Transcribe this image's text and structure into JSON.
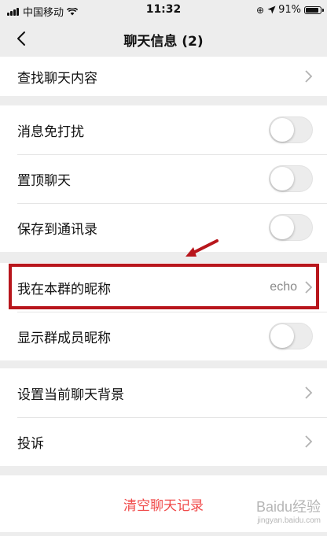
{
  "status_bar": {
    "carrier": "中国移动",
    "time": "11:32",
    "battery": "91%"
  },
  "nav": {
    "title": "聊天信息 (2)"
  },
  "rows": {
    "search": "查找聊天内容",
    "mute": "消息免打扰",
    "pin": "置顶聊天",
    "save_contacts": "保存到通讯录",
    "nickname": "我在本群的昵称",
    "nickname_value": "echo",
    "show_nicknames": "显示群成员昵称",
    "set_background": "设置当前聊天背景",
    "complain": "投诉"
  },
  "clear_history": "清空聊天记录",
  "toggles": {
    "mute": false,
    "pin": false,
    "save_contacts": false,
    "show_nicknames": false
  },
  "watermark": {
    "logo": "Baidu经验",
    "url": "jingyan.baidu.com"
  },
  "colors": {
    "background": "#ededed",
    "danger_text": "#f04a4a",
    "highlight": "#b8161c"
  }
}
